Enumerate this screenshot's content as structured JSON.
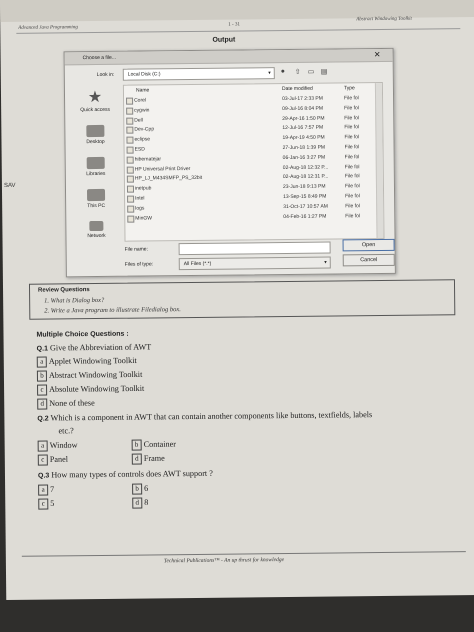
{
  "header": {
    "left": "Advanced Java Programming",
    "center": "1 - 31",
    "right": "Abstract Windowing Toolkit"
  },
  "side_mark": "SAV",
  "output_label": "Output",
  "dialog": {
    "title": "Choose a file...",
    "close": "✕",
    "look_in_label": "Look in:",
    "look_in_value": "Local Disk (C:)",
    "toolbar_icons": [
      "back-icon",
      "up-folder-icon",
      "new-folder-icon",
      "view-menu-icon"
    ],
    "places": [
      {
        "label": "Quick access",
        "icon": "star-icon"
      },
      {
        "label": "Desktop",
        "icon": "desktop-icon"
      },
      {
        "label": "Libraries",
        "icon": "libraries-icon"
      },
      {
        "label": "This PC",
        "icon": "computer-icon"
      },
      {
        "label": "Network",
        "icon": "network-icon"
      }
    ],
    "columns": [
      "Name",
      "Date modified",
      "Type"
    ],
    "files": [
      {
        "name": "Corel",
        "date": "03-Jul-17 2:33 PM",
        "type": "File fol"
      },
      {
        "name": "cygwin",
        "date": "09-Jul-16 8:04 PM",
        "type": "File fol"
      },
      {
        "name": "Dell",
        "date": "29-Apr-16 1:50 PM",
        "type": "File fol"
      },
      {
        "name": "Dev-Cpp",
        "date": "12-Jul-16 7:57 PM",
        "type": "File fol"
      },
      {
        "name": "eclipse",
        "date": "19-Apr-19 4:50 PM",
        "type": "File fol"
      },
      {
        "name": "ESD",
        "date": "27-Jun-18 1:39 PM",
        "type": "File fol"
      },
      {
        "name": "hibernatejar",
        "date": "06-Jan-16 3:27 PM",
        "type": "File fol"
      },
      {
        "name": "HP Universal Print Driver",
        "date": "02-Aug-18 12:32 P...",
        "type": "File fol"
      },
      {
        "name": "HP_LJ_M434SMFP_PS_32bit",
        "date": "02-Aug-18 12:31 P...",
        "type": "File fol"
      },
      {
        "name": "inetpub",
        "date": "23-Jun-18 9:13 PM",
        "type": "File fol"
      },
      {
        "name": "Intel",
        "date": "13-Sep-15 8:49 PM",
        "type": "File fol"
      },
      {
        "name": "logs",
        "date": "31-Oct-17 10:57 AM",
        "type": "File fol"
      },
      {
        "name": "MinGW",
        "date": "04-Feb-16 1:27 PM",
        "type": "File fol"
      }
    ],
    "file_name_label": "File name:",
    "file_name_value": "",
    "file_type_label": "Files of type:",
    "file_type_value": "All Files (*.*)",
    "open_button": "Open",
    "cancel_button": "Cancel"
  },
  "review": {
    "heading": "Review Questions",
    "q1": "1. What is Dialog box?",
    "q2": "2. Write a Java program to illustrate Filedialog box."
  },
  "mcq": {
    "heading": "Multiple Choice Questions :",
    "q1": {
      "num": "Q.1",
      "text": "Give the Abbreviation of AWT",
      "options": [
        {
          "letter": "a",
          "text": "Applet Windowing Toolkit"
        },
        {
          "letter": "b",
          "text": "Abstract Windowing Toolkit"
        },
        {
          "letter": "c",
          "text": "Absolute Windowing Toolkit"
        },
        {
          "letter": "d",
          "text": "None of these"
        }
      ]
    },
    "q2": {
      "num": "Q.2",
      "text": "Which is a component in AWT that can contain another components like buttons, textfields, labels",
      "text2": "etc.?",
      "options": [
        {
          "letter": "a",
          "text": "Window"
        },
        {
          "letter": "b",
          "text": "Container"
        },
        {
          "letter": "c",
          "text": "Panel"
        },
        {
          "letter": "d",
          "text": "Frame"
        }
      ]
    },
    "q3": {
      "num": "Q.3",
      "text": "How many types of controls does AWT support ?",
      "options": [
        {
          "letter": "a",
          "text": "7"
        },
        {
          "letter": "b",
          "text": "6"
        },
        {
          "letter": "c",
          "text": "5"
        },
        {
          "letter": "d",
          "text": "8"
        }
      ]
    }
  },
  "footer": "Technical Publications™ - An up thrust for knowledge"
}
